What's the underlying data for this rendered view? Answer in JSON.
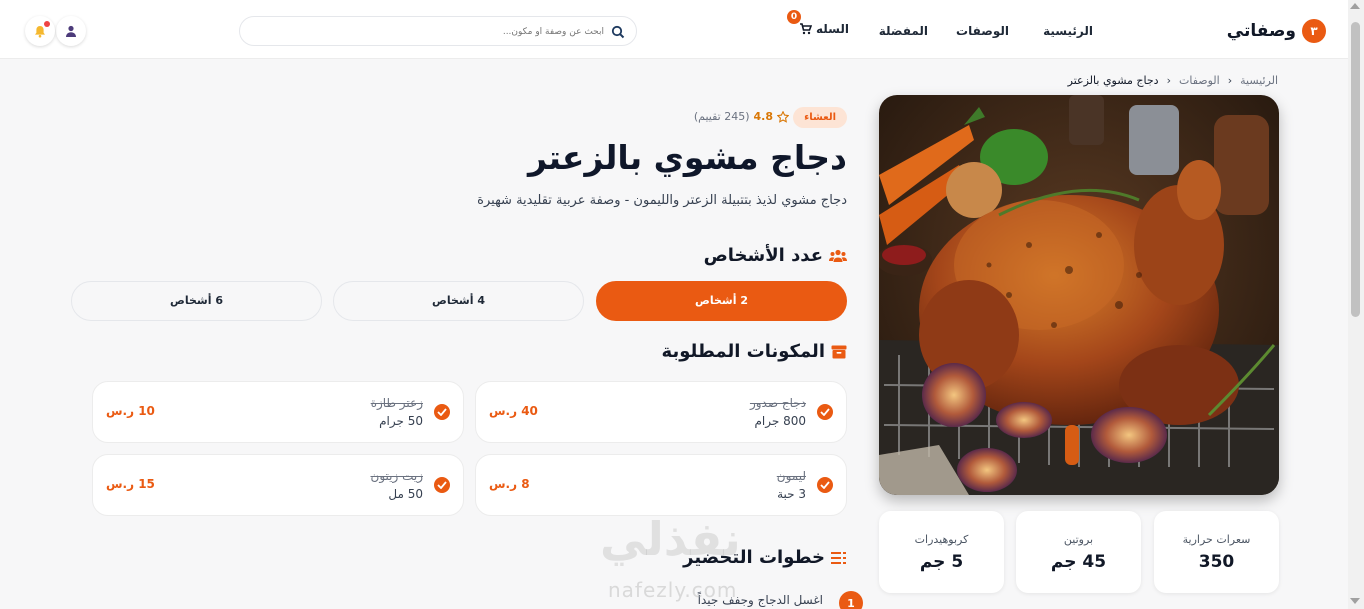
{
  "brand": {
    "name": "وصفاتي",
    "logo_glyph": "٣",
    "accent": "#ea5a12"
  },
  "nav": {
    "home": "الرئيسية",
    "recipes": "الوصفات",
    "favorites": "المفضلة",
    "cart": "السله",
    "cart_count": "0"
  },
  "search": {
    "placeholder": "ابحث عن وصفة أو مكون..."
  },
  "breadcrumb": {
    "home": "الرئيسية",
    "recipes": "الوصفات",
    "current": "دجاج مشوي بالزعتر"
  },
  "recipe": {
    "category": "العشاء",
    "rating": "4.8",
    "reviews": "(245 تقييم)",
    "title": "دجاج مشوي بالزعتر",
    "description": "دجاج مشوي لذيذ بتتبيلة الزعتر والليمون - وصفة عربية تقليدية شهيرة"
  },
  "nutrition": [
    {
      "label": "سعرات حرارية",
      "value": "350"
    },
    {
      "label": "بروتين",
      "value": "45 جم"
    },
    {
      "label": "كربوهيدرات",
      "value": "5 جم"
    }
  ],
  "servings": {
    "title": "عدد الأشخاص",
    "options": [
      "2 أشخاص",
      "4 أشخاص",
      "6 أشخاص"
    ],
    "selected": "2 أشخاص"
  },
  "ingredients": {
    "title": "المكونات المطلوبة",
    "items": [
      {
        "name": "دجاج صدور",
        "qty": "800 جرام",
        "price": "40 ر.س"
      },
      {
        "name": "زعتر طازة",
        "qty": "50 جرام",
        "price": "10 ر.س"
      },
      {
        "name": "ليمون",
        "qty": "3 حبة",
        "price": "8 ر.س"
      },
      {
        "name": "زيت زيتون",
        "qty": "50 مل",
        "price": "15 ر.س"
      }
    ]
  },
  "steps": {
    "title": "خطوات التحضير",
    "items": [
      {
        "num": "1",
        "text": "اغسل الدجاج وجفف جيداً"
      }
    ]
  },
  "watermark": {
    "arabic": "نفذلي",
    "latin": "nafezly.com"
  }
}
